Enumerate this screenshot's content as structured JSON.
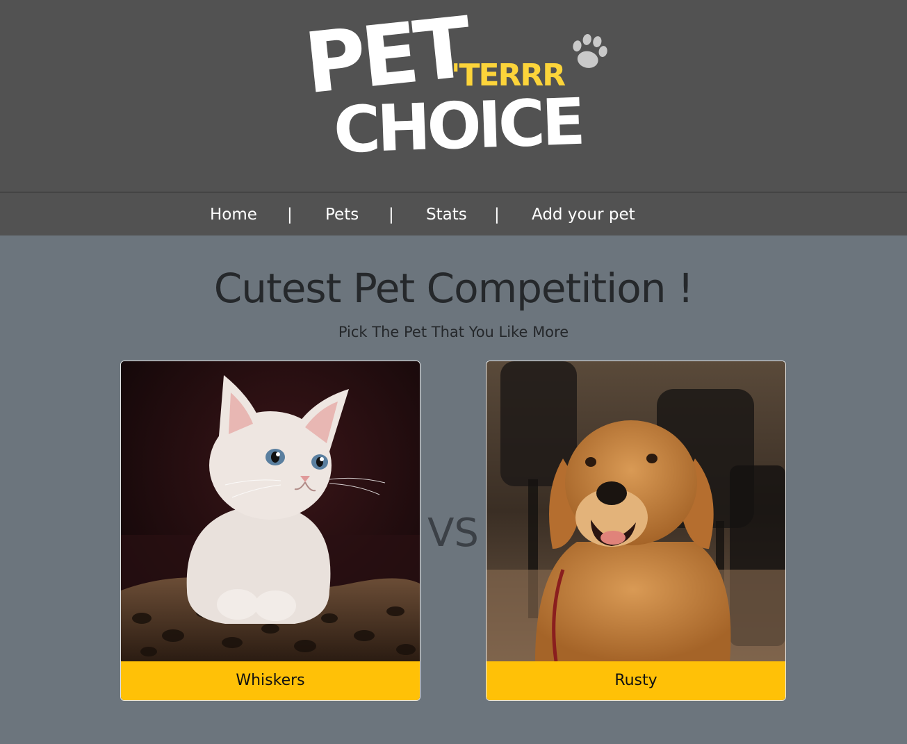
{
  "header": {
    "logo": {
      "line1": "PET",
      "line2": "CHOICE",
      "accent": "'TERRR",
      "accent_color": "#fcd43a",
      "icon": "paw-icon"
    }
  },
  "nav": {
    "items": [
      {
        "label": "Home"
      },
      {
        "label": "Pets"
      },
      {
        "label": "Stats"
      },
      {
        "label": "Add your pet"
      }
    ],
    "separator": "|"
  },
  "main": {
    "title": "Cutest Pet Competition !",
    "subtitle": "Pick The Pet That You Like More",
    "versus": "VS",
    "candidates": [
      {
        "name": "Whiskers",
        "photo": "kitten-photo"
      },
      {
        "name": "Rusty",
        "photo": "golden-retriever-photo"
      }
    ],
    "accent_color": "#ffc107",
    "background_color": "#6c757d"
  }
}
